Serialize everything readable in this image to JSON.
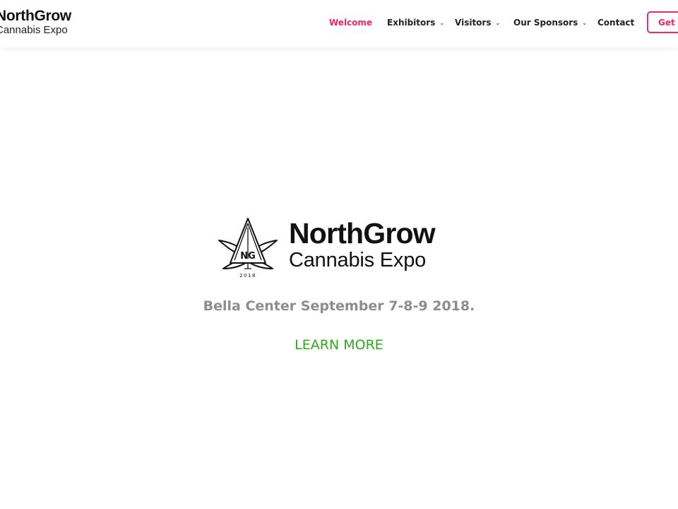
{
  "header": {
    "logo_line1": "NorthGrow",
    "logo_line2": "Cannabis Expo"
  },
  "nav": {
    "items": [
      {
        "label": "Welcome",
        "active": true,
        "has_dropdown": false
      },
      {
        "label": "Exhibitors",
        "active": false,
        "has_dropdown": true
      },
      {
        "label": "Visitors",
        "active": false,
        "has_dropdown": true
      },
      {
        "label": "Our Sponsors",
        "active": false,
        "has_dropdown": true
      },
      {
        "label": "Contact",
        "active": false,
        "has_dropdown": false
      }
    ],
    "ticket_button": "Get T"
  },
  "hero": {
    "logo_line1": "NorthGrow",
    "logo_line2": "Cannabis Expo",
    "logo_monogram": "NG",
    "logo_year": "2018",
    "tagline": "Bella Center September 7-8-9 2018.",
    "cta": "LEARN MORE"
  },
  "colors": {
    "accent": "#f0266a",
    "cta": "#2eaa1e",
    "tagline": "#8d8d8d"
  }
}
